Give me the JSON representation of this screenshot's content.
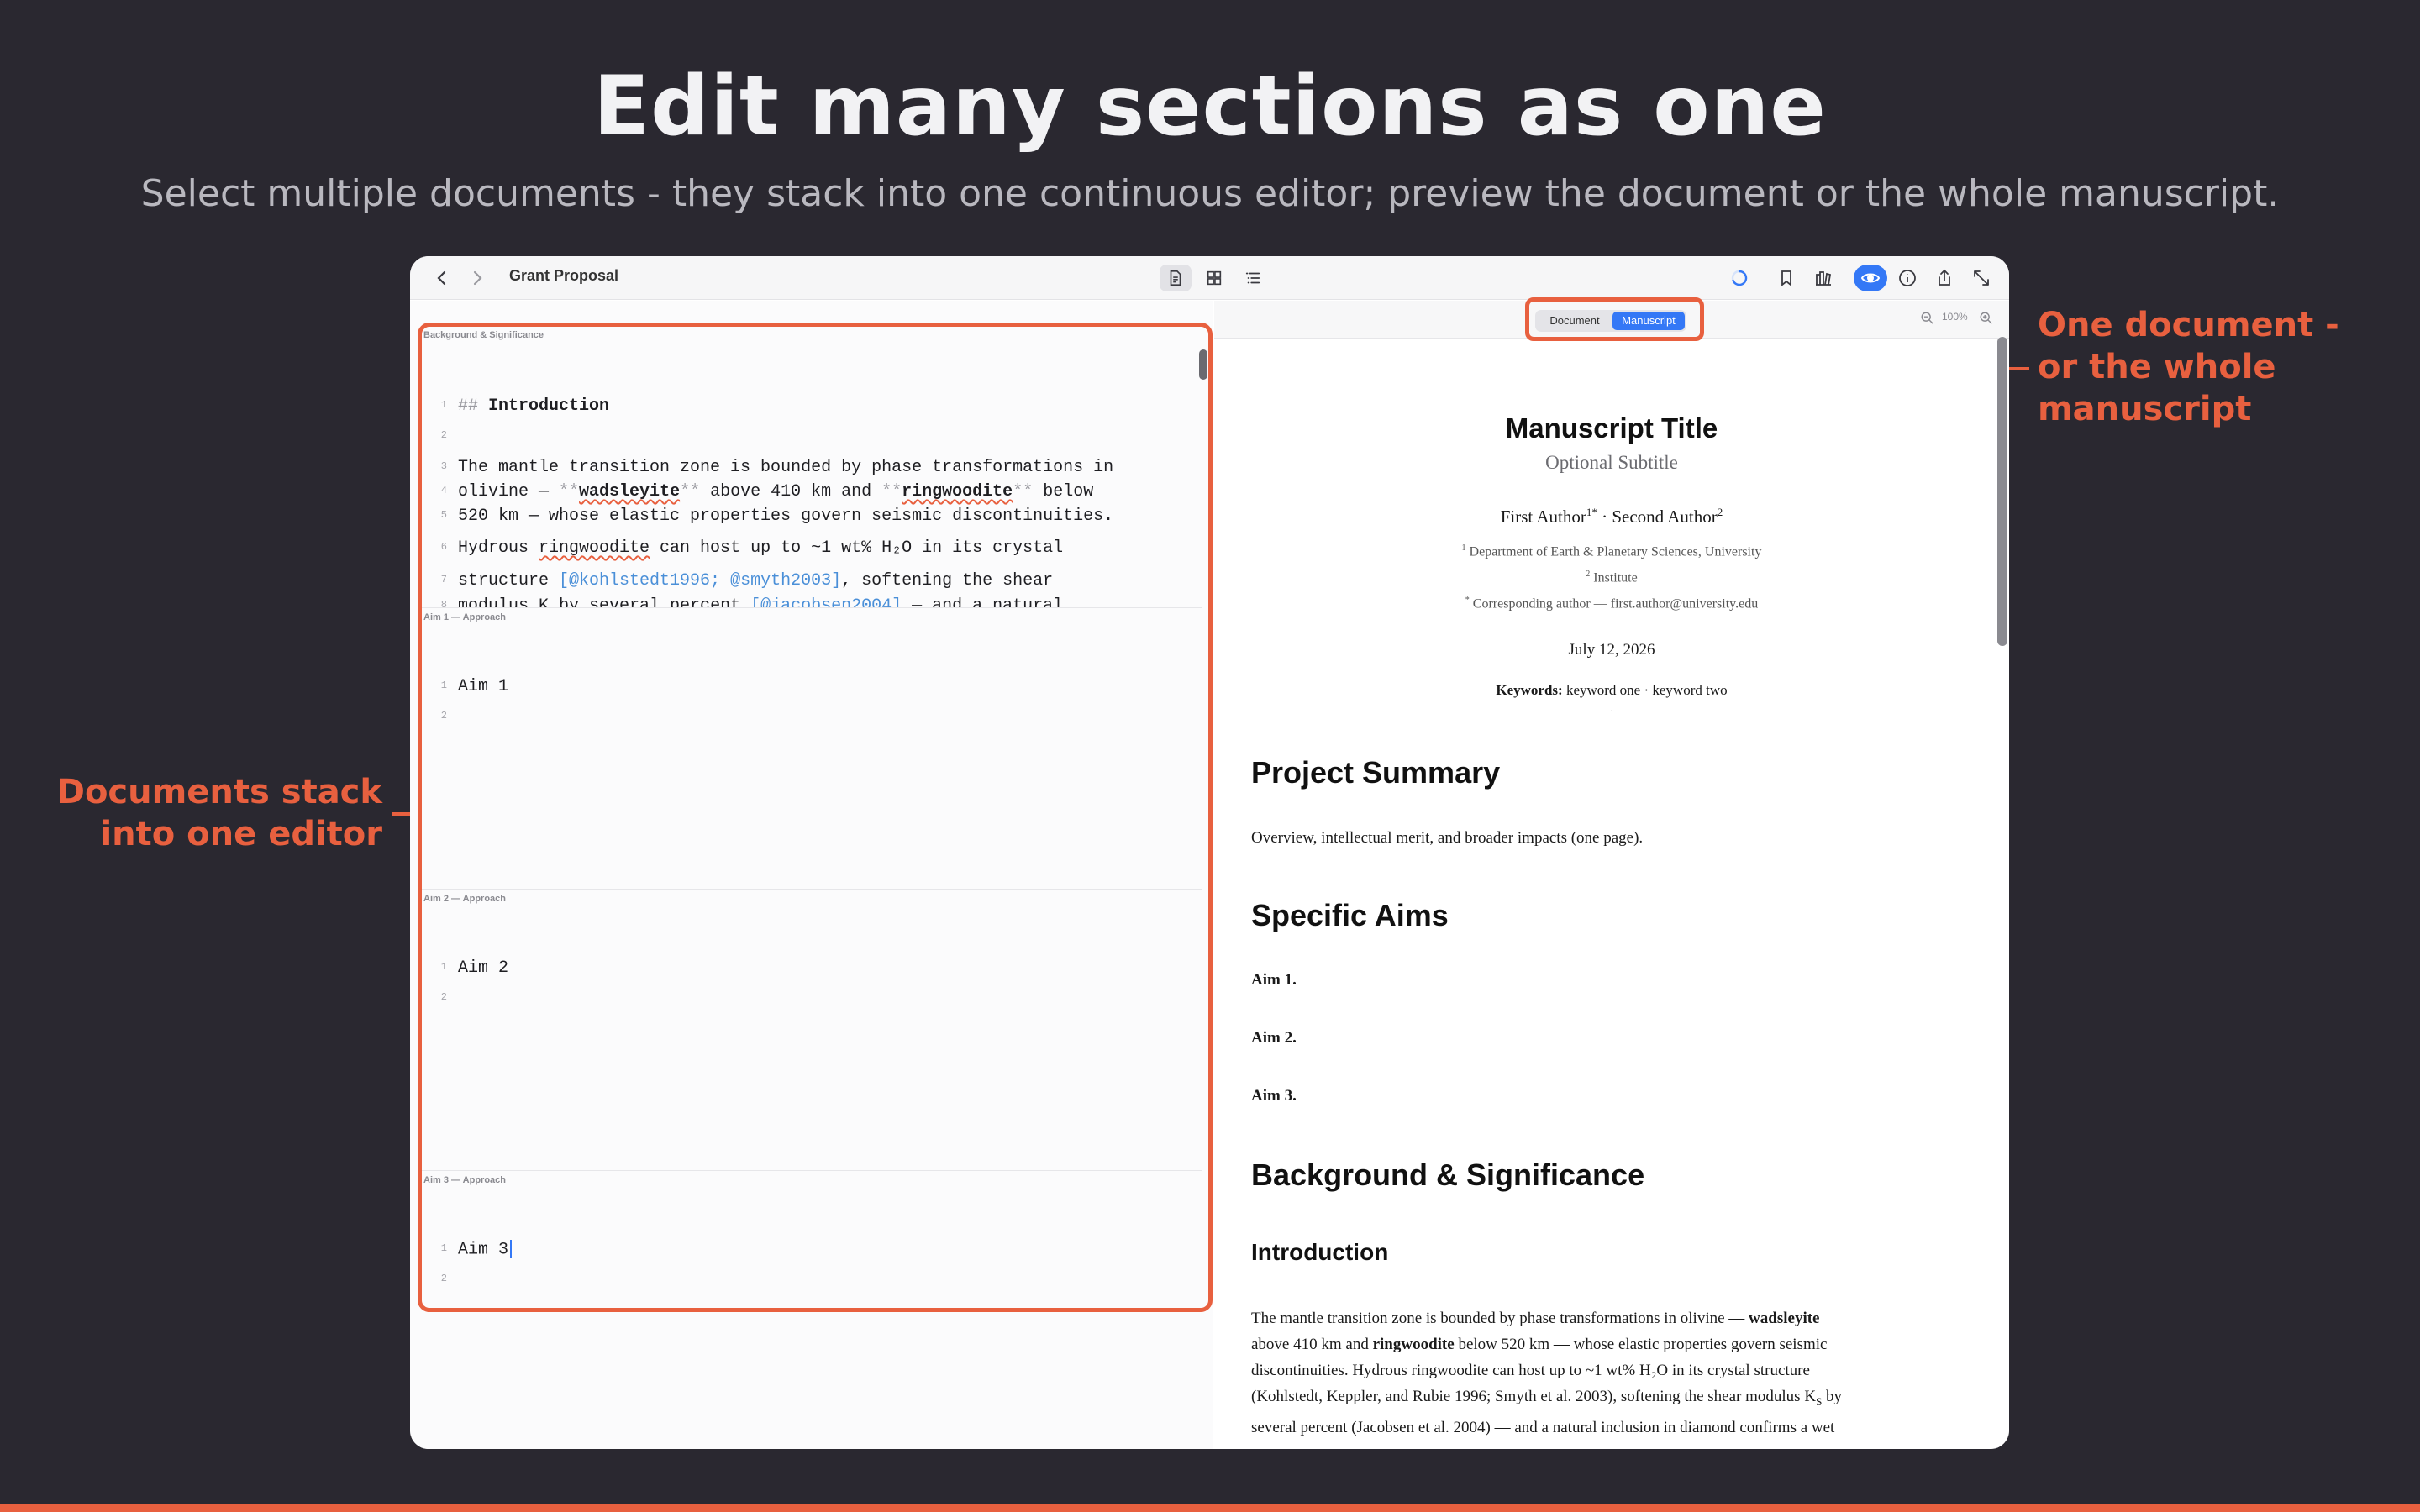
{
  "hero": {
    "title": "Edit many sections as one",
    "subtitle": "Select multiple documents - they stack into one continuous editor; preview the document or the whole manuscript."
  },
  "callouts": {
    "left_line1": "Documents stack",
    "left_line2": "into one editor",
    "right_line1": "One document -",
    "right_line2": "or the whole",
    "right_line3": "manuscript"
  },
  "colors": {
    "accent": "#e8603f",
    "background": "#2a2830",
    "primary": "#3478f6"
  },
  "toolbar": {
    "title": "Grant Proposal",
    "icons": [
      "chevron-left-icon",
      "chevron-right-icon",
      "document-icon",
      "grid-icon",
      "outline-icon",
      "sync-icon",
      "bookmark-icon",
      "library-icon",
      "eye-icon",
      "info-icon",
      "share-icon",
      "expand-icon"
    ]
  },
  "editor": {
    "sections": [
      {
        "title": "Background & Significance",
        "lines": [
          {
            "n": "1"
          },
          {
            "n": "2"
          },
          {
            "n": "3"
          },
          {
            "n": "4"
          },
          {
            "n": "5"
          },
          {
            "n": "6"
          },
          {
            "n": "7"
          },
          {
            "n": "8"
          }
        ],
        "l1_mark": "##",
        "l1_text": "Introduction",
        "l3": "The mantle transition zone is bounded by phase transformations in",
        "l4_a": "olivine — ",
        "l4_m1": "**",
        "l4_b": "wadsleyite",
        "l4_m2": "**",
        "l4_c": " above 410 km and ",
        "l4_m3": "**",
        "l4_d": "ringwoodite",
        "l4_m4": "**",
        "l4_e": " below",
        "l5": "520 km — whose elastic properties govern seismic discontinuities.",
        "l6_a": "Hydrous ",
        "l6_b": "ringwoodite",
        "l6_c": " can host up to ~1 wt% H₂O in its crystal",
        "l7_a": "structure ",
        "l7_b": "[@kohlstedt1996; @smyth2003]",
        "l7_c": ", softening the shear",
        "l8_a": "modulus K",
        "l8_b": " by several percent ",
        "l8_c": "[@jacobsen2004]",
        "l8_d": " — and a natural"
      },
      {
        "title": "Aim 1 — Approach",
        "l1": "Aim 1",
        "n1": "1",
        "n2": "2"
      },
      {
        "title": "Aim 2 — Approach",
        "l1": "Aim 2",
        "n1": "1",
        "n2": "2"
      },
      {
        "title": "Aim 3 — Approach",
        "l1": "Aim 3",
        "n1": "1",
        "n2": "2"
      }
    ]
  },
  "preview": {
    "tabs": {
      "document": "Document",
      "manuscript": "Manuscript",
      "selected": "Manuscript"
    },
    "zoom": "100%",
    "doc": {
      "title": "Manuscript Title",
      "subtitle": "Optional Subtitle",
      "author1": "First Author",
      "author1_sup": "1*",
      "author_sep": " · ",
      "author2": "Second Author",
      "author2_sup": "2",
      "aff1_sup": "1",
      "aff1": " Department of Earth & Planetary Sciences, University",
      "aff2_sup": "2",
      "aff2": " Institute",
      "aff3_sup": "*",
      "aff3": " Corresponding author — first.author@university.edu",
      "date": "July 12, 2026",
      "keywords_label": "Keywords:",
      "keywords": " keyword one · keyword two",
      "dot": ".",
      "h_summary": "Project Summary",
      "summary_text": "Overview, intellectual merit, and broader impacts (one page).",
      "h_aims": "Specific Aims",
      "aim1": "Aim 1.",
      "aim2": "Aim 2.",
      "aim3": "Aim 3.",
      "h_background": "Background & Significance",
      "h_intro": "Introduction",
      "p1_a": "The mantle transition zone is bounded by phase transformations in olivine — ",
      "p1_b": "wadsleyite",
      "p2_a": "above 410 km and ",
      "p2_b": "ringwoodite",
      "p2_c": " below 520 km — whose elastic properties govern seismic",
      "p3": "discontinuities. Hydrous ringwoodite can host up to ~1 wt% H₂O in its crystal structure",
      "p4_a": "(Kohlstedt, Keppler, and Rubie 1996; Smyth et al. 2003), softening the shear modulus K",
      "p4_sub": "S",
      "p4_b": " by",
      "p5": "several percent (Jacobsen et al. 2004) — and a natural inclusion in diamond confirms a wet"
    }
  }
}
